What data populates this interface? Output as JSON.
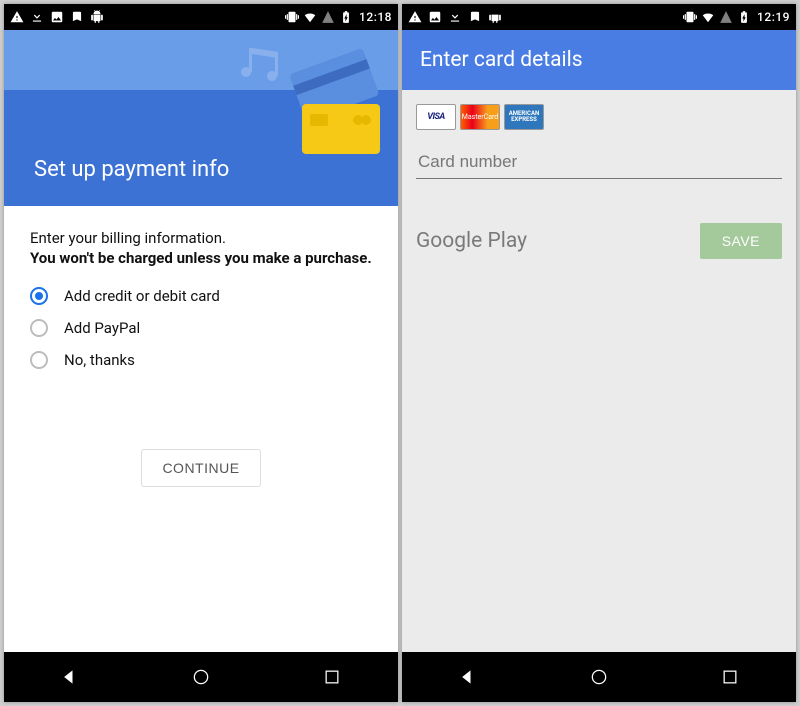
{
  "phone1": {
    "status": {
      "time": "12:18"
    },
    "hero_title": "Set up payment info",
    "intro_line1": "Enter your billing information.",
    "intro_bold": "You won't be charged unless you make a purchase.",
    "options": [
      {
        "label": "Add credit or debit card",
        "selected": true
      },
      {
        "label": "Add PayPal",
        "selected": false
      },
      {
        "label": "No, thanks",
        "selected": false
      }
    ],
    "continue_label": "CONTINUE"
  },
  "phone2": {
    "status": {
      "time": "12:19"
    },
    "title": "Enter card details",
    "card_logos": [
      "VISA",
      "MasterCard",
      "AMERICAN EXPRESS"
    ],
    "card_number_placeholder": "Card number",
    "branding": "Google Play",
    "save_label": "SAVE"
  }
}
